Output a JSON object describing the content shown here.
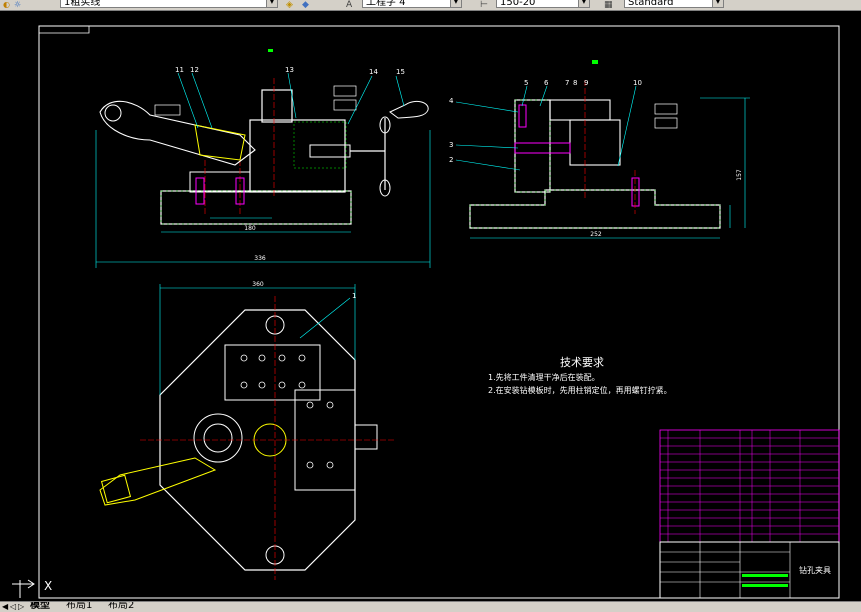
{
  "toolbar": {
    "layer_name": "1粗实线",
    "linetype_name": "工程字 4",
    "lineweight_value": "150-20",
    "style_name": "Standard"
  },
  "drawing": {
    "tech_req_title": "技术要求",
    "tech_req_line1": "1.先将工件清理干净后在装配。",
    "tech_req_line2": "2.在安装钻模板时，先用柱销定位，再用螺钉拧紧。",
    "title_block_name": "钻孔夹具",
    "callouts": [
      "11",
      "12",
      "13",
      "14",
      "15",
      "5",
      "6",
      "7",
      "8",
      "9",
      "10",
      "4",
      "3",
      "2",
      "1"
    ],
    "dim_front_width": "180",
    "dim_front_overall": "336",
    "dim_side_width": "252",
    "dim_side_height": "157",
    "dim_plan_width": "360",
    "ucs_label": "X"
  },
  "layout_tabs": {
    "model": "模型",
    "layout1": "布局1",
    "layout2": "布局2"
  },
  "colors": {
    "background": "#000000",
    "border": "#ffffff",
    "part_outline": "#ffffff",
    "dimension": "#00ffff",
    "centerline": "#ff0000",
    "hatch": "#00ff00",
    "handle": "#ffff00",
    "title_table": "#ff00ff",
    "text": "#ffffff"
  }
}
